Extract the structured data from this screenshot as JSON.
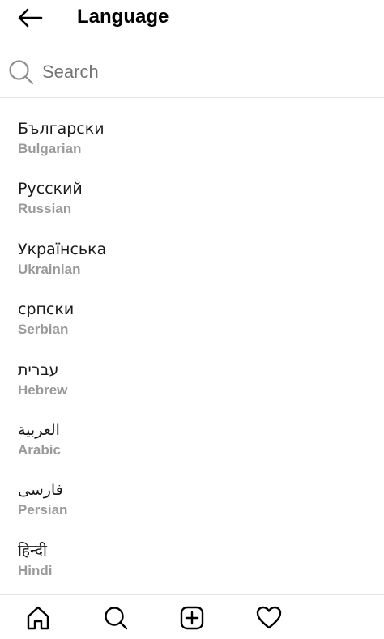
{
  "header": {
    "title": "Language",
    "back_icon": "arrow-left-icon"
  },
  "search": {
    "placeholder": "Search",
    "value": "",
    "icon": "search-icon"
  },
  "languages": [
    {
      "native": "Български",
      "english": "Bulgarian"
    },
    {
      "native": "Русский",
      "english": "Russian"
    },
    {
      "native": "Українська",
      "english": "Ukrainian"
    },
    {
      "native": "српски",
      "english": "Serbian"
    },
    {
      "native": "עברית",
      "english": "Hebrew"
    },
    {
      "native": "العربية",
      "english": "Arabic"
    },
    {
      "native": "فارسی",
      "english": "Persian"
    },
    {
      "native": "हिन्दी",
      "english": "Hindi"
    }
  ],
  "bottom_nav": [
    {
      "icon": "home-icon"
    },
    {
      "icon": "search-icon"
    },
    {
      "icon": "add-post-icon"
    },
    {
      "icon": "heart-icon"
    }
  ],
  "colors": {
    "secondary_text": "#9a9a9a",
    "divider": "#e6e6e6",
    "placeholder": "#737373"
  }
}
